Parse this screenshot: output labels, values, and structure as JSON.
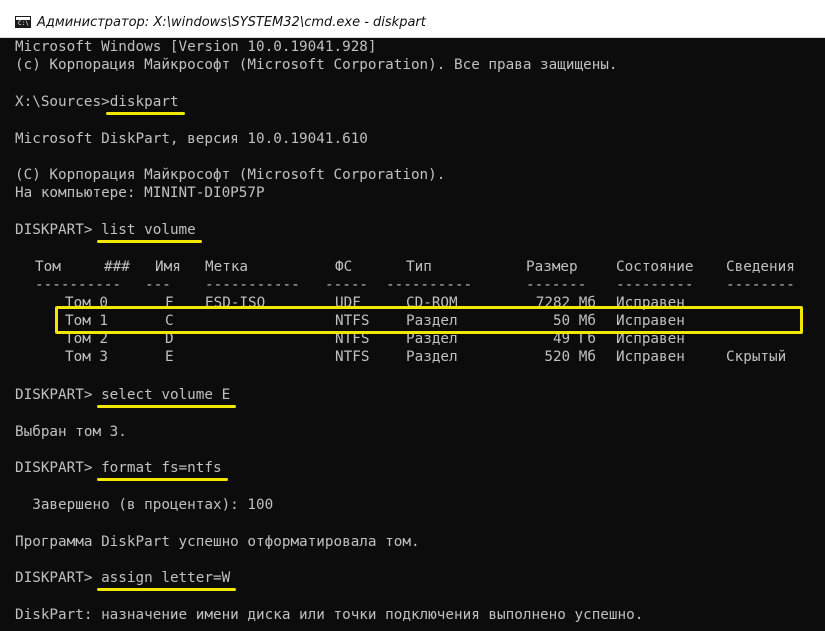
{
  "window": {
    "title": "Администратор: X:\\windows\\SYSTEM32\\cmd.exe - diskpart"
  },
  "console": {
    "l1": "Microsoft Windows [Version 10.0.19041.928]",
    "l2": "(c) Корпорация Майкрософт (Microsoft Corporation). Все права защищены.",
    "p1": "X:\\Sources>",
    "c1": "diskpart",
    "l3": "Microsoft DiskPart, версия 10.0.19041.610",
    "l4": "(C) Корпорация Майкрософт (Microsoft Corporation).",
    "l5": "На компьютере: MININT-DI0P57P",
    "p2": "DISKPART> ",
    "c2": "list volume",
    "p3": "DISKPART> ",
    "c3": "select volume E",
    "l6": "Выбран том 3.",
    "p4": "DISKPART> ",
    "c4": "format fs=ntfs",
    "l7": "  Завершено (в процентах): 100",
    "l8": "Программа DiskPart успешно отформатировала том.",
    "p5": "DISKPART> ",
    "c5": "assign letter=W",
    "l9": "DiskPart: назначение имени диска или точки подключения выполнено успешно."
  },
  "volume_table": {
    "headers": [
      "Том",
      "###",
      "Имя",
      "Метка",
      "ФС",
      "Тип",
      "Размер",
      "Состояние",
      "Сведения"
    ],
    "dashes": [
      "----------",
      "---",
      "-----------",
      "-----",
      "----------",
      "-------",
      "---------",
      "--------"
    ],
    "rows": [
      {
        "vol": "Том 0",
        "ltr": "F",
        "label": "ESD-ISO",
        "fs": "UDF",
        "type": "CD-ROM",
        "size": "7282 Мб",
        "status": "Исправен",
        "info": ""
      },
      {
        "vol": "Том 1",
        "ltr": "C",
        "label": "",
        "fs": "NTFS",
        "type": "Раздел",
        "size": "50 Мб",
        "status": "Исправен",
        "info": ""
      },
      {
        "vol": "Том 2",
        "ltr": "D",
        "label": "",
        "fs": "NTFS",
        "type": "Раздел",
        "size": "49 Гб",
        "status": "Исправен",
        "info": ""
      },
      {
        "vol": "Том 3",
        "ltr": "E",
        "label": "",
        "fs": "NTFS",
        "type": "Раздел",
        "size": "520 Мб",
        "status": "Исправен",
        "info": "Скрытый"
      }
    ]
  }
}
